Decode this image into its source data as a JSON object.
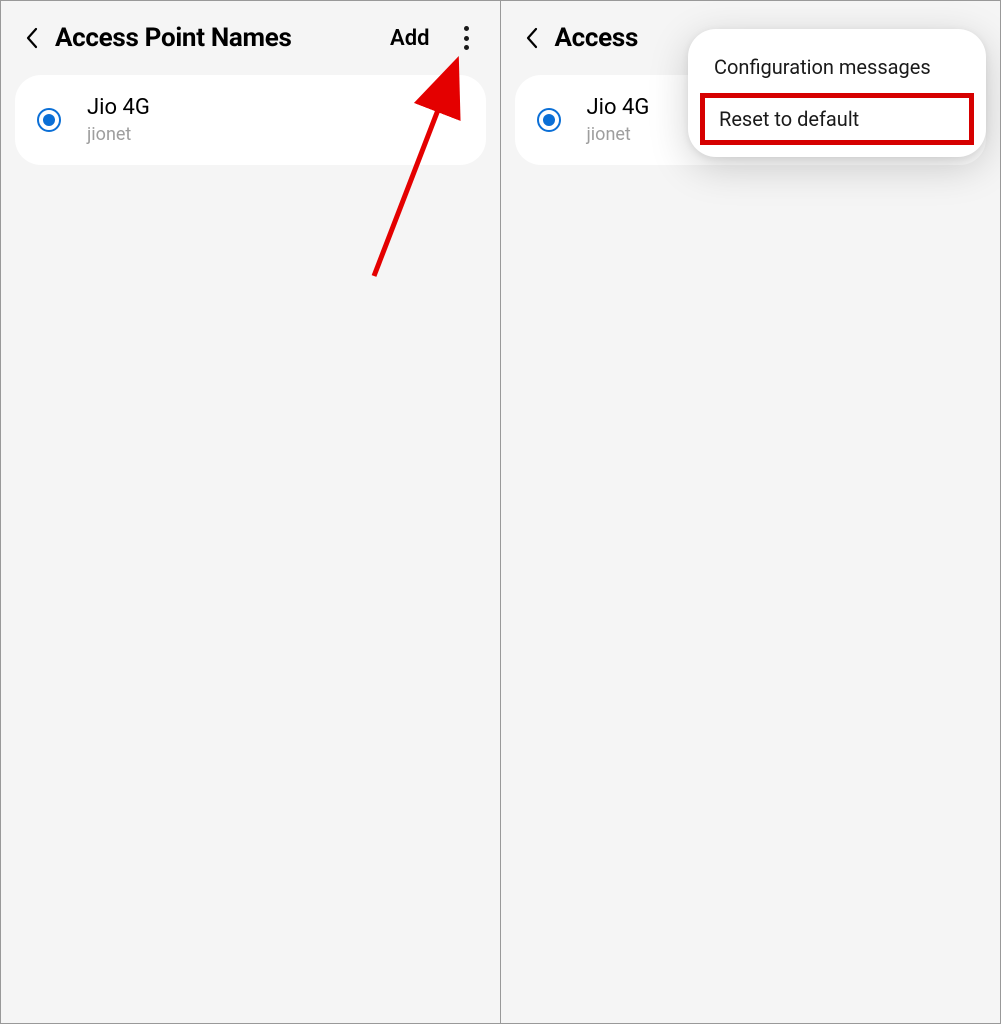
{
  "left": {
    "title": "Access Point Names",
    "add_label": "Add",
    "apn": {
      "name": "Jio 4G",
      "sub": "jionet",
      "selected": true
    }
  },
  "right": {
    "title": "Access",
    "apn": {
      "name": "Jio 4G",
      "sub": "jionet",
      "selected": true
    },
    "menu": {
      "item1": "Configuration messages",
      "item2": "Reset to default"
    }
  }
}
